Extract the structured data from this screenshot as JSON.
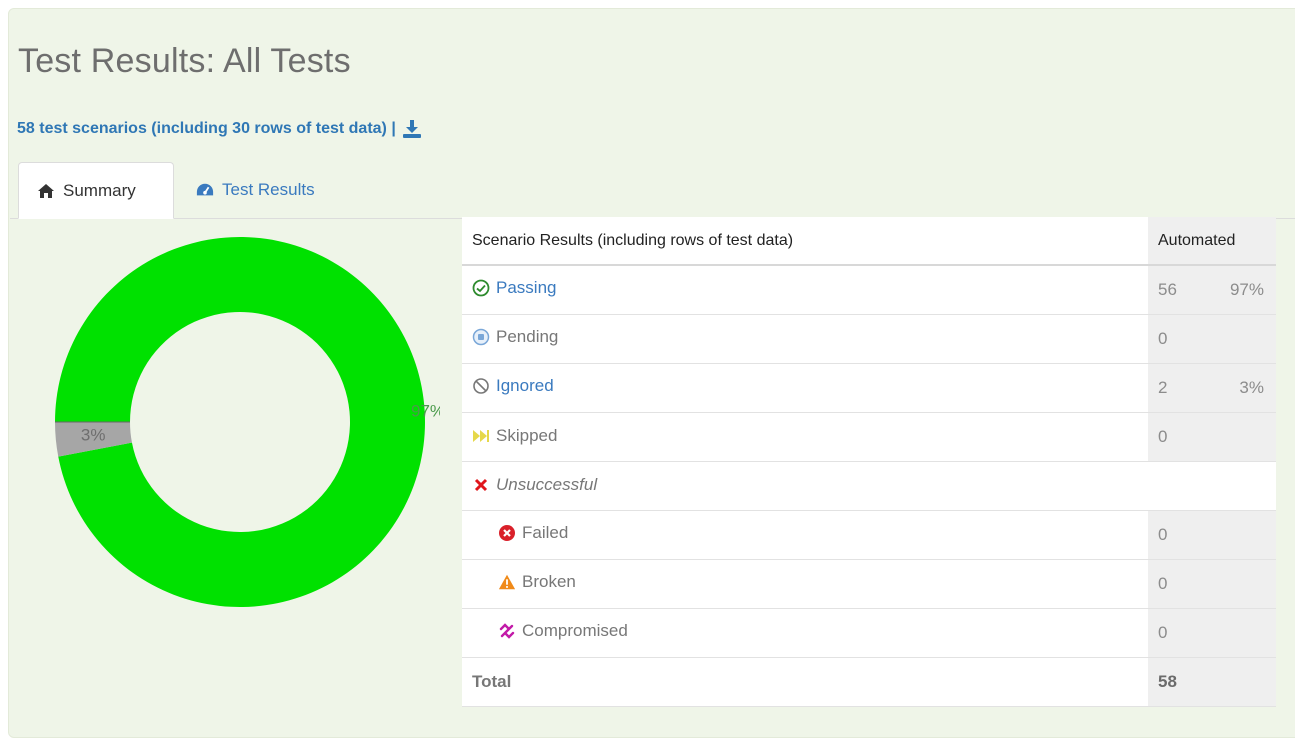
{
  "page": {
    "title": "Test Results: All Tests",
    "summary_text": "58 test scenarios (including 30 rows of test data) |"
  },
  "tabs": [
    {
      "label": "Summary",
      "icon": "home-icon",
      "active": true
    },
    {
      "label": "Test Results",
      "icon": "dashboard-icon",
      "active": false
    }
  ],
  "chart_data": {
    "type": "pie",
    "categories": [
      "Passing",
      "Ignored"
    ],
    "values": [
      97,
      3
    ],
    "labels": [
      "97%",
      "3%"
    ],
    "colors": [
      "#00e100",
      "#a6a6a6"
    ]
  },
  "table": {
    "header_label": "Scenario Results (including rows of test data)",
    "header_auto": "Automated",
    "rows": [
      {
        "label": "Passing",
        "icon": "check-circle-icon",
        "count": "56",
        "percent": "97%",
        "link": true
      },
      {
        "label": "Pending",
        "icon": "pending-circle-icon",
        "count": "0",
        "percent": ""
      },
      {
        "label": "Ignored",
        "icon": "ban-icon",
        "count": "2",
        "percent": "3%",
        "link": true
      },
      {
        "label": "Skipped",
        "icon": "fast-forward-icon",
        "count": "0",
        "percent": ""
      },
      {
        "label": "Unsuccessful",
        "icon": "x-icon"
      },
      {
        "label": "Failed",
        "icon": "times-circle-icon",
        "count": "0"
      },
      {
        "label": "Broken",
        "icon": "warning-icon",
        "count": "0"
      },
      {
        "label": "Compromised",
        "icon": "chain-broken-icon",
        "count": "0"
      }
    ],
    "total_label": "Total",
    "total_value": "58"
  },
  "colors": {
    "panel_bg": "#eff5e8",
    "link": "#3a7abf",
    "passing": "#00e100",
    "ignored": "#a6a6a6"
  }
}
